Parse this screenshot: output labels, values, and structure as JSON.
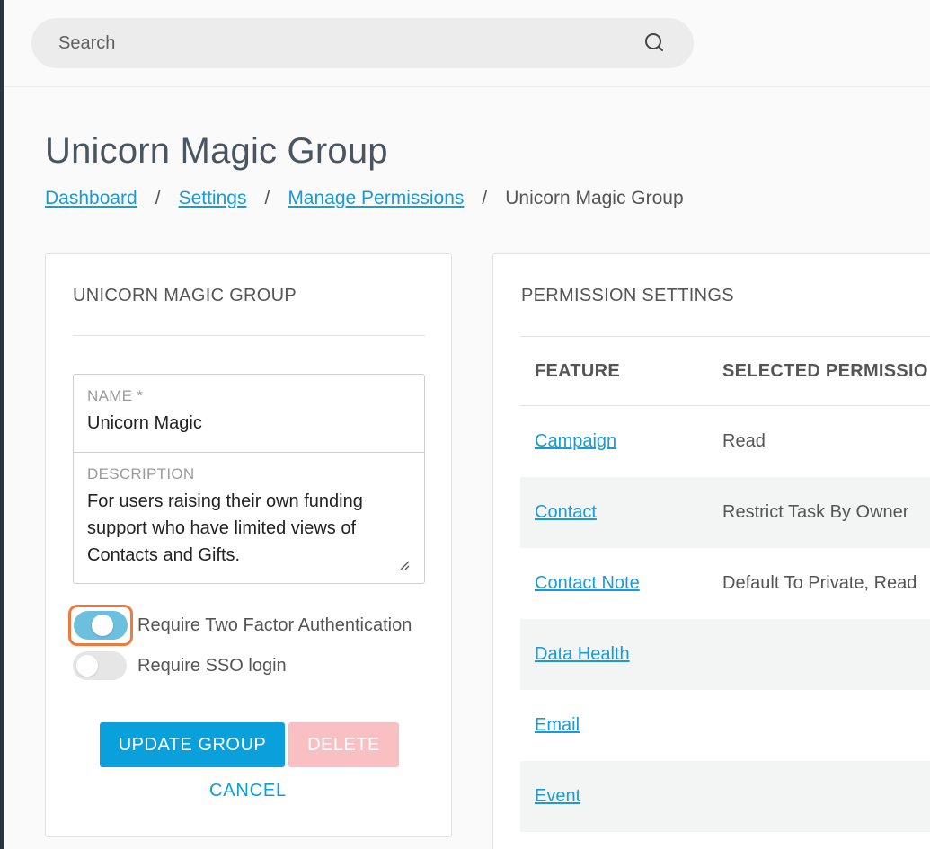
{
  "search": {
    "placeholder": "Search"
  },
  "page": {
    "title": "Unicorn Magic Group"
  },
  "breadcrumb": {
    "items": [
      "Dashboard",
      "Settings",
      "Manage Permissions"
    ],
    "separator": "/",
    "current": "Unicorn Magic Group"
  },
  "group_card": {
    "heading": "UNICORN MAGIC GROUP",
    "name_label": "NAME *",
    "name_value": "Unicorn Magic",
    "description_label": "DESCRIPTION",
    "description_value": "For users raising their own funding support who  have limited views of Contacts and Gifts.",
    "two_factor_label": "Require Two Factor Authentication",
    "two_factor_enabled": true,
    "sso_label": "Require SSO login",
    "sso_enabled": false,
    "update_label": "UPDATE GROUP",
    "delete_label": "DELETE",
    "cancel_label": "CANCEL"
  },
  "permissions_card": {
    "heading": "PERMISSION SETTINGS",
    "columns": [
      "FEATURE",
      "SELECTED PERMISSIO"
    ],
    "rows": [
      {
        "feature": "Campaign",
        "permission": "Read"
      },
      {
        "feature": "Contact",
        "permission": "Restrict Task By Owner"
      },
      {
        "feature": "Contact Note",
        "permission": "Default To Private, Read"
      },
      {
        "feature": "Data Health",
        "permission": ""
      },
      {
        "feature": "Email",
        "permission": ""
      },
      {
        "feature": "Event",
        "permission": ""
      }
    ]
  },
  "colors": {
    "link": "#1a9ad6",
    "primary_button": "#0aa0dc",
    "delete_button_disabled": "#f9c0c4",
    "toggle_on": "#6cc0de",
    "focus_ring": "#f07a3c"
  }
}
